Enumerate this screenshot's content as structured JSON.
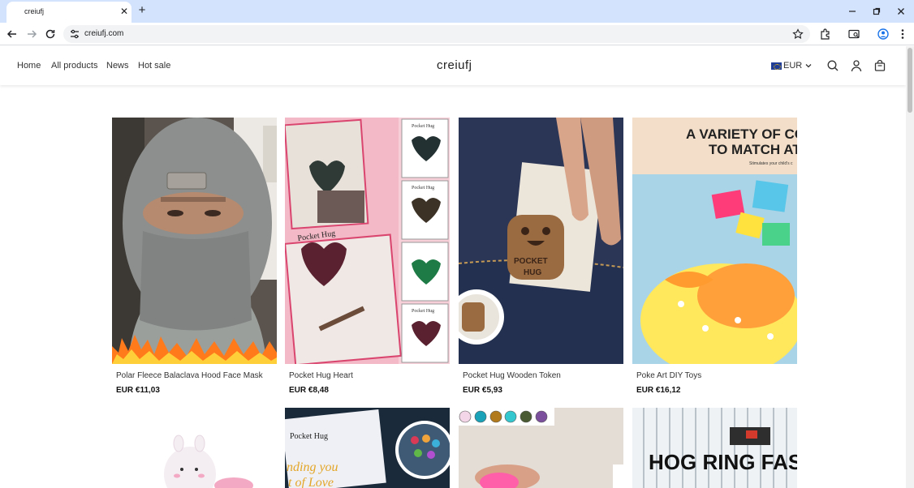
{
  "browser": {
    "tab_title": "creiufj",
    "url": "creiufj.com"
  },
  "store": {
    "brand": "creiufj",
    "nav": [
      "Home",
      "All products",
      "News",
      "Hot sale"
    ],
    "currency": "EUR"
  },
  "products": [
    {
      "name": "Polar Fleece Balaclava Hood Face Mask",
      "price": "EUR €11,03"
    },
    {
      "name": "Pocket Hug Heart",
      "price": "EUR €8,48"
    },
    {
      "name": "Pocket Hug Wooden Token",
      "price": "EUR €5,93"
    },
    {
      "name": "Poke Art DIY Toys",
      "price": "EUR €16,12"
    }
  ],
  "image_text": {
    "pocket_hug": "Pocket Hug",
    "pocket_hug_token_line1": "POCKET",
    "pocket_hug_token_line2": "HUG",
    "variety_line1": "A VARIETY OF CO",
    "variety_line2": "TO MATCH AT",
    "variety_sub": "Stimulates your child's c",
    "hog_ring": "HOG RING FASTE",
    "sending_you": "nding you",
    "love": "t of Love",
    "pocket_hug_2": "Pocket Hug"
  },
  "colors": {
    "tabbar": "#d3e3fd",
    "omnibox": "#f1f3f4",
    "swatches": [
      "#f3d6e8",
      "#1aa3b8",
      "#b07a1d",
      "#35c7cf",
      "#4a5a32",
      "#7b4f9c"
    ]
  },
  "icons": {
    "tab_close": "close-icon",
    "new_tab": "plus-icon",
    "back": "arrow-left-icon",
    "forward": "arrow-right-icon",
    "reload": "reload-icon",
    "site_info": "tune-icon",
    "bookmark": "star-icon",
    "extensions": "puzzle-icon",
    "cast": "cast-icon",
    "profile": "profile-icon",
    "menu": "more-vert-icon",
    "search": "search-icon",
    "account": "user-icon",
    "cart": "cart-icon"
  }
}
